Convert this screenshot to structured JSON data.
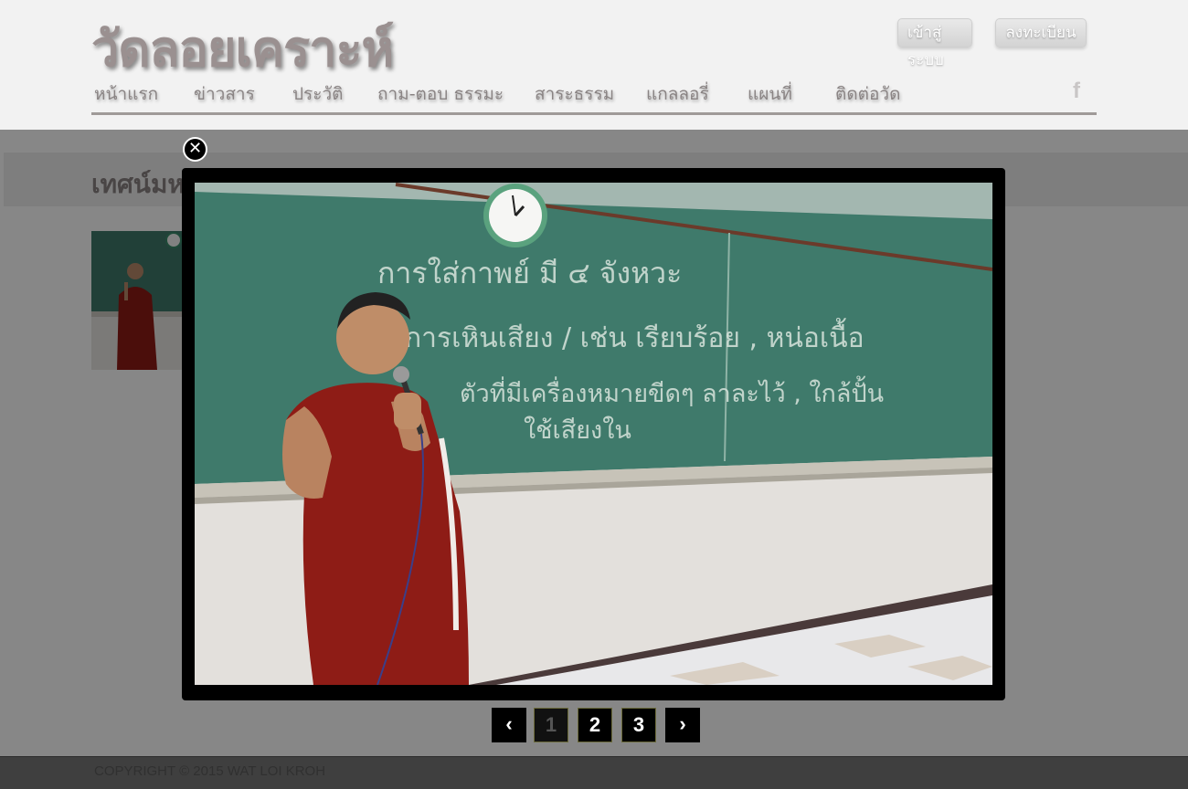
{
  "site": {
    "title": "วัดลอยเคราะห์",
    "login_label": "เข้าสู่ระบบ",
    "register_label": "ลงทะเบียน",
    "facebook_icon": "f"
  },
  "nav": {
    "items": [
      {
        "label": "หน้าแรก"
      },
      {
        "label": "ข่าวสาร"
      },
      {
        "label": "ประวัติ"
      },
      {
        "label": "ถาม-ตอบ ธรรมะ"
      },
      {
        "label": "สาระธรรม"
      },
      {
        "label": "แกลลอรี่"
      },
      {
        "label": "แผนที่"
      },
      {
        "label": "ติดต่อวัด"
      }
    ]
  },
  "page": {
    "heading": "เทศน์มห"
  },
  "lightbox": {
    "close_icon": "✕",
    "photo": {
      "board_lines": [
        "การใส่กาพย์ มี ๔ จังหวะ",
        "การเหินเสียง  /  เช่น  เรียบร้อย , หน่อเนื้อ",
        "ตัวที่มีเครื่องหมายขีดๆ ลาละไว้ , ใกล้ปั้น",
        "ใช้เสียงใน"
      ]
    },
    "pagination": {
      "prev": "‹",
      "next": "›",
      "pages": [
        "1",
        "2",
        "3"
      ],
      "current": "1"
    }
  },
  "footer": {
    "copyright": "COPYRIGHT © 2015 WAT LOI KROH"
  },
  "colors": {
    "overlay": "#000000",
    "nav_text": "#8a8484",
    "title_text": "#9a9090",
    "robe": "#8e1c16",
    "chalkboard": "#3f7a6b"
  }
}
